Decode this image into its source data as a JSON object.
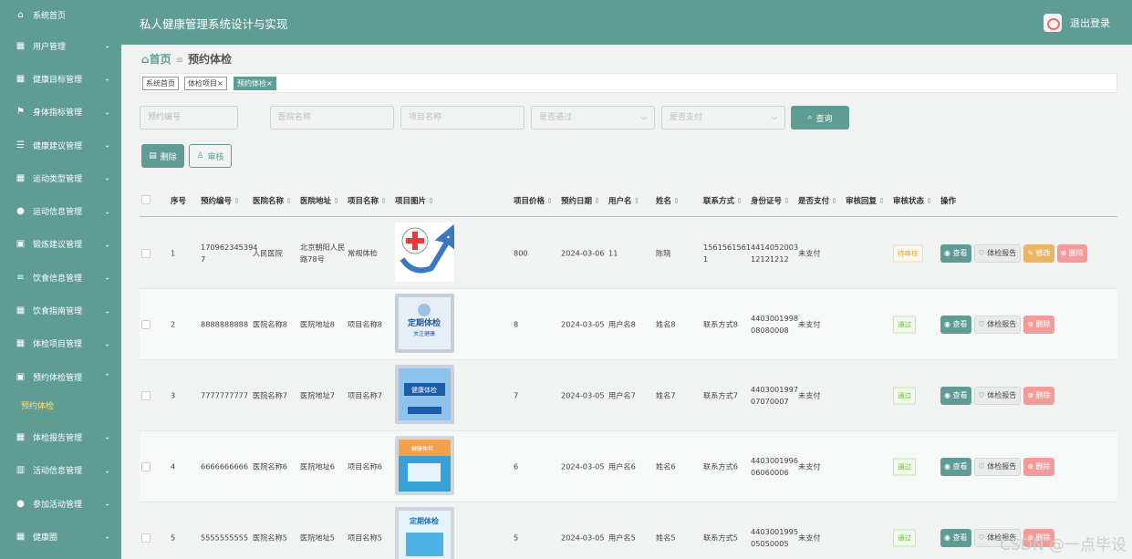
{
  "sidebar": {
    "items": [
      {
        "label": "系统首页",
        "icon": "home-icon",
        "glyph": "⌂"
      },
      {
        "label": "用户管理",
        "icon": "grid-icon",
        "glyph": "▦"
      },
      {
        "label": "健康目标管理",
        "icon": "grid-icon",
        "glyph": "▦"
      },
      {
        "label": "身体指标管理",
        "icon": "flag-icon",
        "glyph": "⚑"
      },
      {
        "label": "健康建议管理",
        "icon": "sliders-icon",
        "glyph": "☰"
      },
      {
        "label": "运动类型管理",
        "icon": "grid-icon",
        "glyph": "▦"
      },
      {
        "label": "运动信息管理",
        "icon": "user-icon",
        "glyph": "●"
      },
      {
        "label": "锻炼建议管理",
        "icon": "clipboard-icon",
        "glyph": "▣"
      },
      {
        "label": "饮食信息管理",
        "icon": "list-icon",
        "glyph": "≡"
      },
      {
        "label": "饮食指南管理",
        "icon": "grid-icon",
        "glyph": "▦"
      },
      {
        "label": "体检项目管理",
        "icon": "grid-icon",
        "glyph": "▦"
      },
      {
        "label": "预约体检管理",
        "icon": "clipboard-icon",
        "glyph": "▣",
        "active": true
      }
    ],
    "submenu_label": "预约体检",
    "items_after": [
      {
        "label": "体检报告管理",
        "icon": "grid-icon",
        "glyph": "▦"
      },
      {
        "label": "活动信息管理",
        "icon": "barcode-icon",
        "glyph": "▥"
      },
      {
        "label": "参加活动管理",
        "icon": "user-icon",
        "glyph": "●"
      },
      {
        "label": "健康圈",
        "icon": "grid-icon",
        "glyph": "▦"
      }
    ]
  },
  "header": {
    "title": "私人健康管理系统设计与实现",
    "logout_label": "退出登录"
  },
  "breadcrumb": {
    "home": "首页",
    "current": "预约体检"
  },
  "tags": [
    "系统首页",
    "体检项目",
    "预约体检"
  ],
  "filters": {
    "booking_no": "预约编号",
    "hospital": "医院名称",
    "project": "项目名称",
    "approved": "是否通过",
    "paid": "是否支付",
    "query_label": "查询"
  },
  "actions": {
    "delete_label": "删除",
    "audit_label": "审核"
  },
  "table": {
    "columns": [
      "序号",
      "预约编号",
      "医院名称",
      "医院地址",
      "项目名称",
      "项目图片",
      "项目价格",
      "预约日期",
      "用户名",
      "姓名",
      "联系方式",
      "身份证号",
      "是否支付",
      "审核回复",
      "审核状态",
      "操作"
    ],
    "op_labels": {
      "view": "查看",
      "report": "体检报告",
      "edit": "修改",
      "delete": "删除"
    },
    "rows": [
      {
        "idx": "1",
        "no_l1": "170962345394",
        "no_l2": "7",
        "hospital": "人民医院",
        "addr_l1": "北京朝阳人民",
        "addr_l2": "路78号",
        "project": "常规体检",
        "price": "800",
        "date": "2024-03-06",
        "user": "11",
        "name": "陈晓",
        "phone_l1": "1561561561",
        "phone_l2": "1",
        "id_l1": "4414052003",
        "id_l2": "12121212",
        "paid": "未支付",
        "status": "待审核",
        "status_type": "wait",
        "can_edit": true,
        "img": "logo"
      },
      {
        "idx": "2",
        "no_l1": "8888888888",
        "no_l2": "",
        "hospital": "医院名称8",
        "addr_l1": "医院地址8",
        "addr_l2": "",
        "project": "项目名称8",
        "price": "8",
        "date": "2024-03-05",
        "user": "用户名8",
        "name": "姓名8",
        "phone_l1": "联系方式8",
        "phone_l2": "",
        "id_l1": "4403001998",
        "id_l2": "08080008",
        "paid": "未支付",
        "status": "通过",
        "status_type": "ok",
        "can_edit": false,
        "img": "poster1"
      },
      {
        "idx": "3",
        "no_l1": "7777777777",
        "no_l2": "",
        "hospital": "医院名称7",
        "addr_l1": "医院地址7",
        "addr_l2": "",
        "project": "项目名称7",
        "price": "7",
        "date": "2024-03-05",
        "user": "用户名7",
        "name": "姓名7",
        "phone_l1": "联系方式7",
        "phone_l2": "",
        "id_l1": "4403001997",
        "id_l2": "07070007",
        "paid": "未支付",
        "status": "通过",
        "status_type": "ok",
        "can_edit": false,
        "img": "poster2"
      },
      {
        "idx": "4",
        "no_l1": "6666666666",
        "no_l2": "",
        "hospital": "医院名称6",
        "addr_l1": "医院地址6",
        "addr_l2": "",
        "project": "项目名称6",
        "price": "6",
        "date": "2024-03-05",
        "user": "用户名6",
        "name": "姓名6",
        "phone_l1": "联系方式6",
        "phone_l2": "",
        "id_l1": "4403001996",
        "id_l2": "06060006",
        "paid": "未支付",
        "status": "通过",
        "status_type": "ok",
        "can_edit": false,
        "img": "poster3"
      },
      {
        "idx": "5",
        "no_l1": "5555555555",
        "no_l2": "",
        "hospital": "医院名称5",
        "addr_l1": "医院地址5",
        "addr_l2": "",
        "project": "项目名称5",
        "price": "5",
        "date": "2024-03-05",
        "user": "用户名5",
        "name": "姓名5",
        "phone_l1": "联系方式5",
        "phone_l2": "",
        "id_l1": "4403001995",
        "id_l2": "05050005",
        "paid": "未支付",
        "status": "通过",
        "status_type": "ok",
        "can_edit": false,
        "img": "poster4"
      }
    ]
  },
  "watermark": "CSDN @一点毕设"
}
